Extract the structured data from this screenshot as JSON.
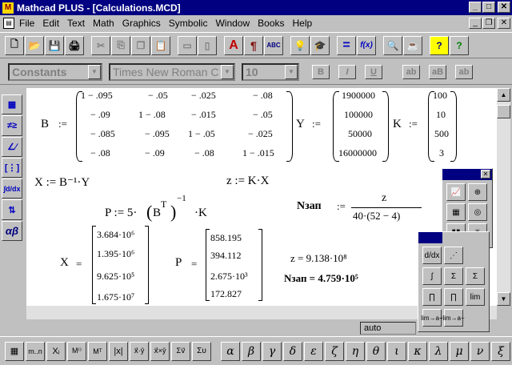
{
  "window": {
    "title": "Mathcad PLUS - [Calculations.MCD]",
    "min": "_",
    "max": "□",
    "close": "✕",
    "doc_min": "_",
    "doc_restore": "❐",
    "doc_close": "✕"
  },
  "menu": [
    "File",
    "Edit",
    "Text",
    "Math",
    "Graphics",
    "Symbolic",
    "Window",
    "Books",
    "Help"
  ],
  "toolbar": {
    "new": "🗋",
    "open": "📂",
    "save": "💾",
    "print": "🖨",
    "cut": "✂",
    "copy": "⎘",
    "copy2": "❐",
    "paste": "📋",
    "align_h": "▭",
    "align_v": "▯",
    "insert_text": "A",
    "paragraph": "¶",
    "spell": "ABC",
    "lightbulb": "💡",
    "hat": "🎓",
    "equals": "=",
    "fx": "f(x)",
    "zoom": "🔍",
    "resource": "☕",
    "help_q": "?",
    "help_q2": "?"
  },
  "format": {
    "style": "Constants",
    "font": "Times New Roman C",
    "size": "10",
    "bold": "B",
    "italic": "I",
    "underline": "U",
    "ab": "ab",
    "aB": "aB",
    "ab_sub": "ab"
  },
  "left_palette": [
    "▦",
    "≠≥",
    "∠∕",
    "[⋮]",
    "∫d/dx",
    "⇅",
    "αβ"
  ],
  "math": {
    "B_label": "B",
    "assign": ":=",
    "B": [
      [
        "1 − .095",
        "− .05",
        "− .025",
        "− .08"
      ],
      [
        "− .09",
        "1 − .08",
        "− .015",
        "− .05"
      ],
      [
        "− .085",
        "− .095",
        "1 − .05",
        "− .025"
      ],
      [
        "− .08",
        "− .09",
        "− .08",
        "1 − .015"
      ]
    ],
    "Y_label": "Y",
    "Y": [
      "1900000",
      "100000",
      "50000",
      "16000000"
    ],
    "K_label": "K",
    "K": [
      "100",
      "10",
      "500",
      "3"
    ],
    "X_def": "X := B⁻¹·Y",
    "z_def": "z := K·X",
    "P_def_lhs": "P := 5·",
    "P_def_B": "B",
    "P_def_T": "T",
    "P_def_m1": "−1",
    "P_def_K": "·K",
    "N_label": "Nзап",
    "N_num": "z",
    "N_den": "40·(52 − 4)",
    "X_res_label": "X",
    "eq": "=",
    "X_res": [
      "3.684·10⁶",
      "1.395·10⁶",
      "9.625·10⁵",
      "1.675·10⁷"
    ],
    "P_res_label": "P",
    "P_res": [
      "858.195",
      "394.112",
      "2.675·10³",
      "172.827"
    ],
    "z_res": "z = 9.138·10⁸",
    "N_res": "Nзап = 4.759·10⁵"
  },
  "status": "auto",
  "bottom": [
    "▦",
    "m..n",
    "Xᵢ",
    "M⁽⁾",
    "Mᵀ",
    "|x|",
    "x⃗·ŷ",
    "x⃗×ŷ",
    "Σv⃗",
    "Συ"
  ],
  "greek": [
    "α",
    "β",
    "γ",
    "δ",
    "ε",
    "ζ",
    "η",
    "θ",
    "ι",
    "κ",
    "λ",
    "μ",
    "ν",
    "ξ"
  ],
  "graph_palette": [
    "📈",
    "⊕",
    "▦",
    "◎",
    "▮▮",
    "✳",
    "⋰"
  ],
  "calculus_palette": [
    "d/dx",
    "∫",
    "Σ",
    "Σ",
    "∏",
    "∏",
    "lim",
    "lim→a+",
    "lim→a−"
  ]
}
